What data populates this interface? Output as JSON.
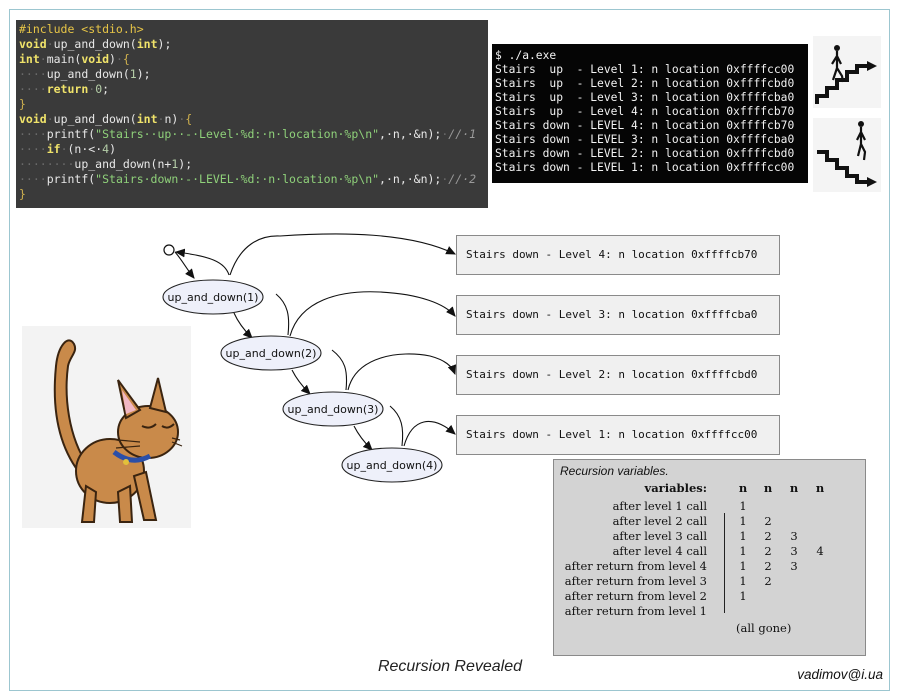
{
  "code_lines": [
    [
      [
        "pp",
        "#include <stdio.h>"
      ]
    ],
    [
      [
        "kw",
        "void"
      ],
      [
        "ws",
        "·"
      ],
      [
        "fn",
        "up_and_down("
      ],
      [
        "kw",
        "int"
      ],
      [
        "fn",
        ");"
      ]
    ],
    [
      [
        "kw",
        "int"
      ],
      [
        "ws",
        "·"
      ],
      [
        "fn",
        "main("
      ],
      [
        "kw",
        "void"
      ],
      [
        "fn",
        ")"
      ],
      [
        "ws",
        "·"
      ],
      [
        "br",
        "{"
      ]
    ],
    [
      [
        "ws",
        "····"
      ],
      [
        "fn",
        "up_and_down("
      ],
      [
        "num",
        "1"
      ],
      [
        "fn",
        ");"
      ]
    ],
    [
      [
        "ws",
        "····"
      ],
      [
        "kw",
        "return"
      ],
      [
        "ws",
        "·"
      ],
      [
        "num",
        "0"
      ],
      [
        "fn",
        ";"
      ]
    ],
    [
      [
        "br",
        "}"
      ]
    ],
    [
      [
        "kw",
        "void"
      ],
      [
        "ws",
        "·"
      ],
      [
        "fn",
        "up_and_down("
      ],
      [
        "kw",
        "int"
      ],
      [
        "ws",
        "·"
      ],
      [
        "fn",
        "n)"
      ],
      [
        "ws",
        "·"
      ],
      [
        "br",
        "{"
      ]
    ],
    [
      [
        "ws",
        "····"
      ],
      [
        "fn",
        "printf("
      ],
      [
        "str",
        "\"Stairs··up··-·Level·%d:·n·location·%p\\n\""
      ],
      [
        "fn",
        ",·n,·&n);"
      ],
      [
        "ws",
        "·"
      ],
      [
        "cm",
        "//·1"
      ]
    ],
    [
      [
        "ws",
        "····"
      ],
      [
        "kw",
        "if"
      ],
      [
        "ws",
        "·"
      ],
      [
        "fn",
        "(n·<·"
      ],
      [
        "num",
        "4"
      ],
      [
        "fn",
        ")"
      ]
    ],
    [
      [
        "ws",
        "········"
      ],
      [
        "fn",
        "up_and_down(n+"
      ],
      [
        "num",
        "1"
      ],
      [
        "fn",
        ");"
      ]
    ],
    [
      [
        "ws",
        "····"
      ],
      [
        "fn",
        "printf("
      ],
      [
        "str",
        "\"Stairs·down·-·LEVEL·%d:·n·location·%p\\n\""
      ],
      [
        "fn",
        ",·n,·&n);"
      ],
      [
        "ws",
        "·"
      ],
      [
        "cm",
        "//·2"
      ]
    ],
    [
      [
        "br",
        "}"
      ]
    ]
  ],
  "terminal": {
    "lines": [
      "$ ./a.exe",
      "Stairs  up  - Level 1: n location 0xffffcc00",
      "Stairs  up  - Level 2: n location 0xffffcbd0",
      "Stairs  up  - Level 3: n location 0xffffcba0",
      "Stairs  up  - Level 4: n location 0xffffcb70",
      "Stairs down - LEVEL 4: n location 0xffffcb70",
      "Stairs down - LEVEL 3: n location 0xffffcba0",
      "Stairs down - LEVEL 2: n location 0xffffcbd0",
      "Stairs down - LEVEL 1: n location 0xffffcc00"
    ]
  },
  "diagram": {
    "nodes": [
      "up_and_down(1)",
      "up_and_down(2)",
      "up_and_down(3)",
      "up_and_down(4)"
    ],
    "messages": [
      "Stairs down - Level 4: n location 0xffffcb70",
      "Stairs down - Level 3: n location 0xffffcba0",
      "Stairs down - Level 2: n location 0xffffcbd0",
      "Stairs down - Level 1: n location 0xffffcc00"
    ]
  },
  "variables": {
    "title": "Recursion variables.",
    "header_label": "variables:",
    "columns": [
      "n",
      "n",
      "n",
      "n"
    ],
    "rows": [
      {
        "label": "after level 1 call",
        "values": [
          "1"
        ]
      },
      {
        "label": "after level 2 call",
        "values": [
          "1",
          "2"
        ]
      },
      {
        "label": "after level 3 call",
        "values": [
          "1",
          "2",
          "3"
        ]
      },
      {
        "label": "after level 4 call",
        "values": [
          "1",
          "2",
          "3",
          "4"
        ]
      },
      {
        "label": "after return from level 4",
        "values": [
          "1",
          "2",
          "3"
        ]
      },
      {
        "label": "after return from level 3",
        "values": [
          "1",
          "2"
        ]
      },
      {
        "label": "after return from level 2",
        "values": [
          "1"
        ]
      },
      {
        "label": "after return from level 1",
        "values": []
      }
    ],
    "footer": "(all gone)"
  },
  "caption": "Recursion Revealed",
  "email": "vadimov@i.ua"
}
